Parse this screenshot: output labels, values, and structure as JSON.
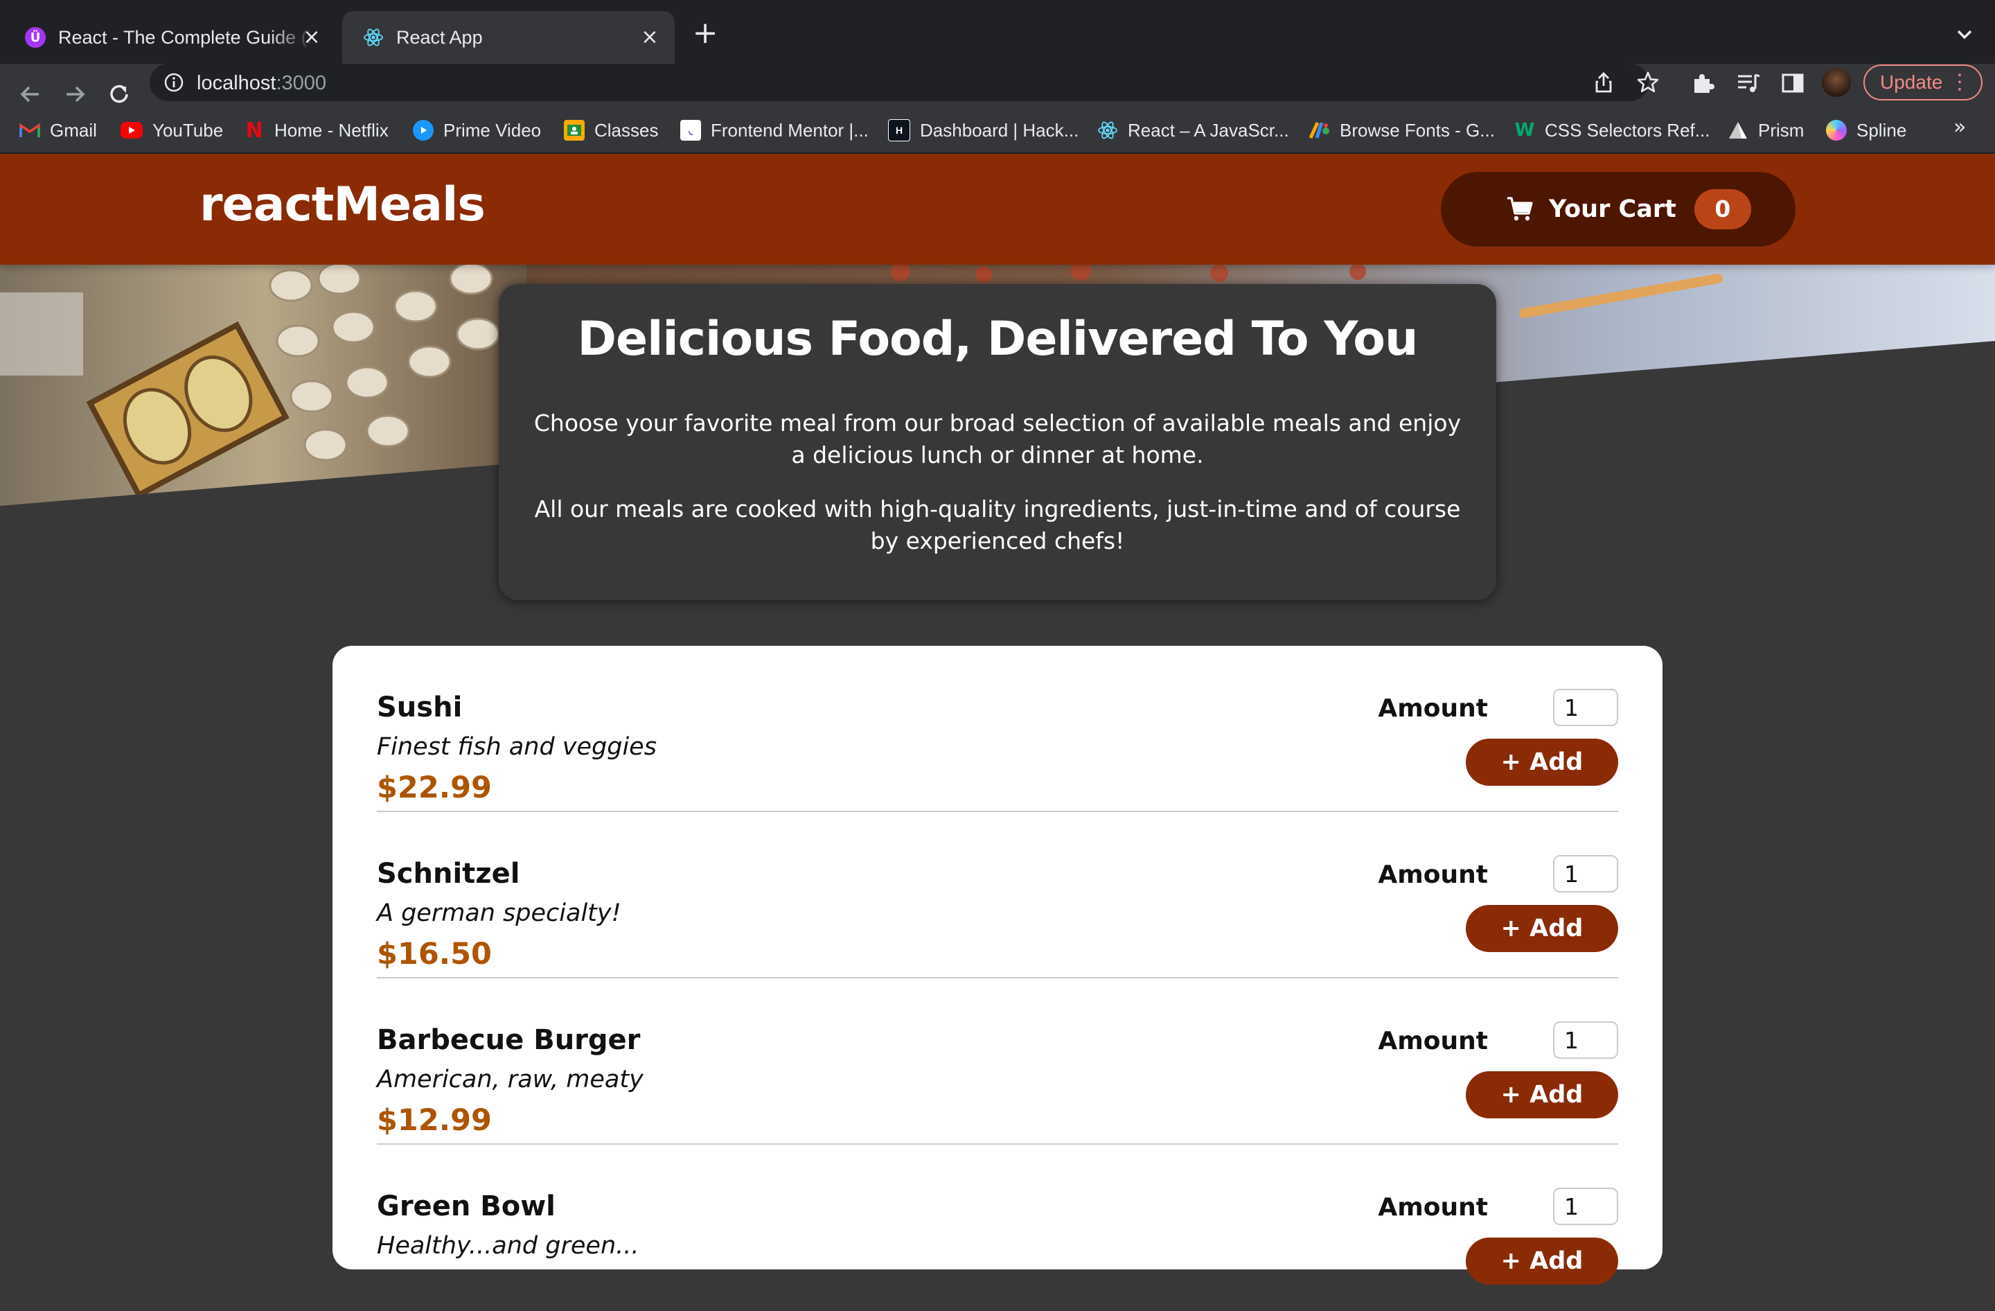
{
  "browser": {
    "tabs": [
      {
        "title": "React - The Complete Guide (i"
      },
      {
        "title": "React App"
      }
    ],
    "address": {
      "host": "localhost",
      "port": ":3000"
    },
    "update_label": "Update",
    "bookmarks": [
      {
        "label": "Gmail",
        "icon": "gmail-icon"
      },
      {
        "label": "YouTube",
        "icon": "youtube-icon"
      },
      {
        "label": "Home - Netflix",
        "icon": "netflix-icon"
      },
      {
        "label": "Prime Video",
        "icon": "prime-video-icon"
      },
      {
        "label": "Classes",
        "icon": "classes-icon"
      },
      {
        "label": "Frontend Mentor |...",
        "icon": "frontend-mentor-icon"
      },
      {
        "label": "Dashboard | Hack...",
        "icon": "hackerrank-icon"
      },
      {
        "label": "React – A JavaScr...",
        "icon": "react-icon"
      },
      {
        "label": "Browse Fonts - G...",
        "icon": "google-fonts-icon"
      },
      {
        "label": "CSS Selectors Ref...",
        "icon": "w3schools-icon"
      },
      {
        "label": "Prism",
        "icon": "prism-icon"
      },
      {
        "label": "Spline",
        "icon": "spline-icon"
      }
    ],
    "bookmarks_overflow": "»"
  },
  "app": {
    "title": "reactMeals",
    "cart": {
      "label": "Your Cart",
      "count": "0"
    }
  },
  "summary": {
    "title": "Delicious Food, Delivered To You",
    "p1": "Choose your favorite meal from our broad selection of available meals and enjoy a delicious lunch or dinner at home.",
    "p2": "All our meals are cooked with high-quality ingredients, just-in-time and of course by experienced chefs!"
  },
  "meals": [
    {
      "name": "Sushi",
      "description": "Finest fish and veggies",
      "price": "$22.99",
      "amount_label": "Amount",
      "amount": "1",
      "add_label": "+ Add"
    },
    {
      "name": "Schnitzel",
      "description": "A german specialty!",
      "price": "$16.50",
      "amount_label": "Amount",
      "amount": "1",
      "add_label": "+ Add"
    },
    {
      "name": "Barbecue Burger",
      "description": "American, raw, meaty",
      "price": "$12.99",
      "amount_label": "Amount",
      "amount": "1",
      "add_label": "+ Add"
    },
    {
      "name": "Green Bowl",
      "description": "Healthy...and green...",
      "price": "",
      "amount_label": "Amount",
      "amount": "1",
      "add_label": "+ Add"
    }
  ],
  "colors": {
    "header": "#8a2b06",
    "cart_button": "#4d1601",
    "cart_badge": "#b94517",
    "price": "#ad5502",
    "page_background": "#383838"
  }
}
